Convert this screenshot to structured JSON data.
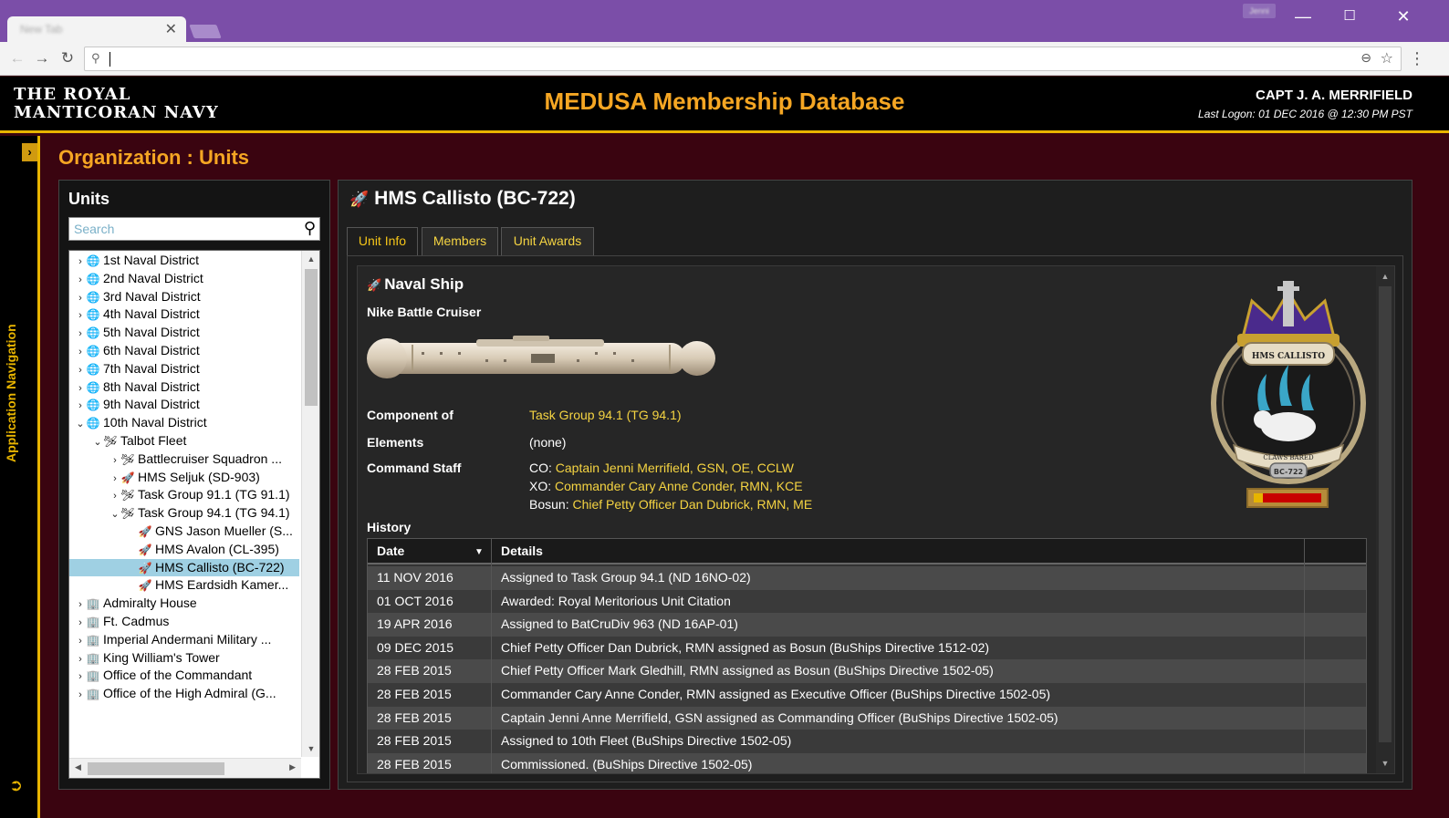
{
  "browser": {
    "tab_title": "New Tab",
    "close_glyph": "✕",
    "profile": "Jenni",
    "url": "",
    "window_minimize": "—",
    "window_maximize": "☐",
    "window_close": "✕"
  },
  "header": {
    "brand_line1": "THE ROYAL",
    "brand_line2": "MANTICORAN NAVY",
    "title": "MEDUSA Membership Database",
    "user": "CAPT J. A. MERRIFIELD",
    "last_logon": "Last Logon: 01 DEC 2016 @ 12:30 PM PST"
  },
  "sidenav": {
    "label": "Application Navigation"
  },
  "page_title": "Organization : Units",
  "units": {
    "heading": "Units",
    "search_placeholder": "Search",
    "tree": [
      {
        "caret": "›",
        "icon": "globe-icon",
        "label": "1st Naval District",
        "level": 0
      },
      {
        "caret": "›",
        "icon": "globe-icon",
        "label": "2nd Naval District",
        "level": 0
      },
      {
        "caret": "›",
        "icon": "globe-icon",
        "label": "3rd Naval District",
        "level": 0
      },
      {
        "caret": "›",
        "icon": "globe-icon",
        "label": "4th Naval District",
        "level": 0
      },
      {
        "caret": "›",
        "icon": "globe-icon",
        "label": "5th Naval District",
        "level": 0
      },
      {
        "caret": "›",
        "icon": "globe-icon",
        "label": "6th Naval District",
        "level": 0
      },
      {
        "caret": "›",
        "icon": "globe-icon",
        "label": "7th Naval District",
        "level": 0
      },
      {
        "caret": "›",
        "icon": "globe-icon",
        "label": "8th Naval District",
        "level": 0
      },
      {
        "caret": "›",
        "icon": "globe-icon",
        "label": "9th Naval District",
        "level": 0
      },
      {
        "caret": "⌄",
        "icon": "globe-icon",
        "label": "10th Naval District",
        "level": 0
      },
      {
        "caret": "⌄",
        "icon": "fleet-icon",
        "label": "Talbot Fleet",
        "level": 1
      },
      {
        "caret": "›",
        "icon": "fleet-icon",
        "label": "Battlecruiser Squadron ...",
        "level": 2
      },
      {
        "caret": "›",
        "icon": "ship-icon",
        "label": "HMS Seljuk (SD-903)",
        "level": 2
      },
      {
        "caret": "›",
        "icon": "fleet-icon",
        "label": "Task Group 91.1 (TG 91.1)",
        "level": 2
      },
      {
        "caret": "⌄",
        "icon": "fleet-icon",
        "label": "Task Group 94.1 (TG 94.1)",
        "level": 2
      },
      {
        "caret": "",
        "icon": "ship-icon",
        "label": "GNS Jason Mueller (S...",
        "level": 3
      },
      {
        "caret": "",
        "icon": "ship-icon",
        "label": "HMS Avalon (CL-395)",
        "level": 3
      },
      {
        "caret": "",
        "icon": "ship-icon",
        "label": "HMS Callisto (BC-722)",
        "level": 3,
        "selected": true
      },
      {
        "caret": "",
        "icon": "ship-icon",
        "label": "HMS Eardsidh Kamer...",
        "level": 3
      },
      {
        "caret": "›",
        "icon": "building-icon",
        "label": "Admiralty House",
        "level": 0
      },
      {
        "caret": "›",
        "icon": "building-icon",
        "label": "Ft. Cadmus",
        "level": 0
      },
      {
        "caret": "›",
        "icon": "building-icon",
        "label": "Imperial Andermani Military ...",
        "level": 0
      },
      {
        "caret": "›",
        "icon": "building-icon",
        "label": "King William's Tower",
        "level": 0
      },
      {
        "caret": "›",
        "icon": "building-icon",
        "label": "Office of the Commandant",
        "level": 0
      },
      {
        "caret": "›",
        "icon": "building-icon",
        "label": "Office of the High Admiral (G...",
        "level": 0
      }
    ]
  },
  "detail": {
    "title": "HMS Callisto (BC-722)",
    "tabs": [
      "Unit Info",
      "Members",
      "Unit Awards"
    ],
    "section_title": "Naval Ship",
    "ship_class": "Nike Battle Cruiser",
    "component_label": "Component of",
    "component_value": "Task Group 94.1 (TG 94.1)",
    "elements_label": "Elements",
    "elements_value": "(none)",
    "staff_label": "Command Staff",
    "staff": [
      {
        "role": "CO:",
        "name": "Captain Jenni Merrifield, GSN, OE, CCLW"
      },
      {
        "role": "XO:",
        "name": "Commander Cary Anne Conder, RMN, KCE"
      },
      {
        "role": "Bosun:",
        "name": "Chief Petty Officer Dan Dubrick, RMN, ME"
      }
    ],
    "crest_name": "HMS CALLISTO",
    "crest_motto": "CLAWS BARED",
    "crest_hull": "BC-722",
    "history_title": "History",
    "history_headers": [
      "Date",
      "Details"
    ],
    "history": [
      {
        "date": "11 NOV 2016",
        "details": "Assigned to Task Group 94.1 (ND 16NO-02)"
      },
      {
        "date": "01 OCT 2016",
        "details": "Awarded: Royal Meritorious Unit Citation"
      },
      {
        "date": "19 APR 2016",
        "details": "Assigned to BatCruDiv 963 (ND 16AP-01)"
      },
      {
        "date": "09 DEC 2015",
        "details": "Chief Petty Officer Dan Dubrick, RMN assigned as Bosun (BuShips Directive 1512-02)"
      },
      {
        "date": "28 FEB 2015",
        "details": "Chief Petty Officer Mark Gledhill, RMN assigned as Bosun (BuShips Directive 1502-05)"
      },
      {
        "date": "28 FEB 2015",
        "details": "Commander Cary Anne Conder, RMN assigned as Executive Officer (BuShips Directive 1502-05)"
      },
      {
        "date": "28 FEB 2015",
        "details": "Captain Jenni Anne Merrifield, GSN assigned as Commanding Officer (BuShips Directive 1502-05)"
      },
      {
        "date": "28 FEB 2015",
        "details": "Assigned to 10th Fleet (BuShips Directive 1502-05)"
      },
      {
        "date": "28 FEB 2015",
        "details": "Commissioned. (BuShips Directive 1502-05)"
      }
    ]
  },
  "colors": {
    "accent": "#e8b400",
    "title_orange": "#f5a623",
    "link_yellow": "#f5d442",
    "selected_row": "#9fd0e3",
    "background": "#3a0410"
  }
}
